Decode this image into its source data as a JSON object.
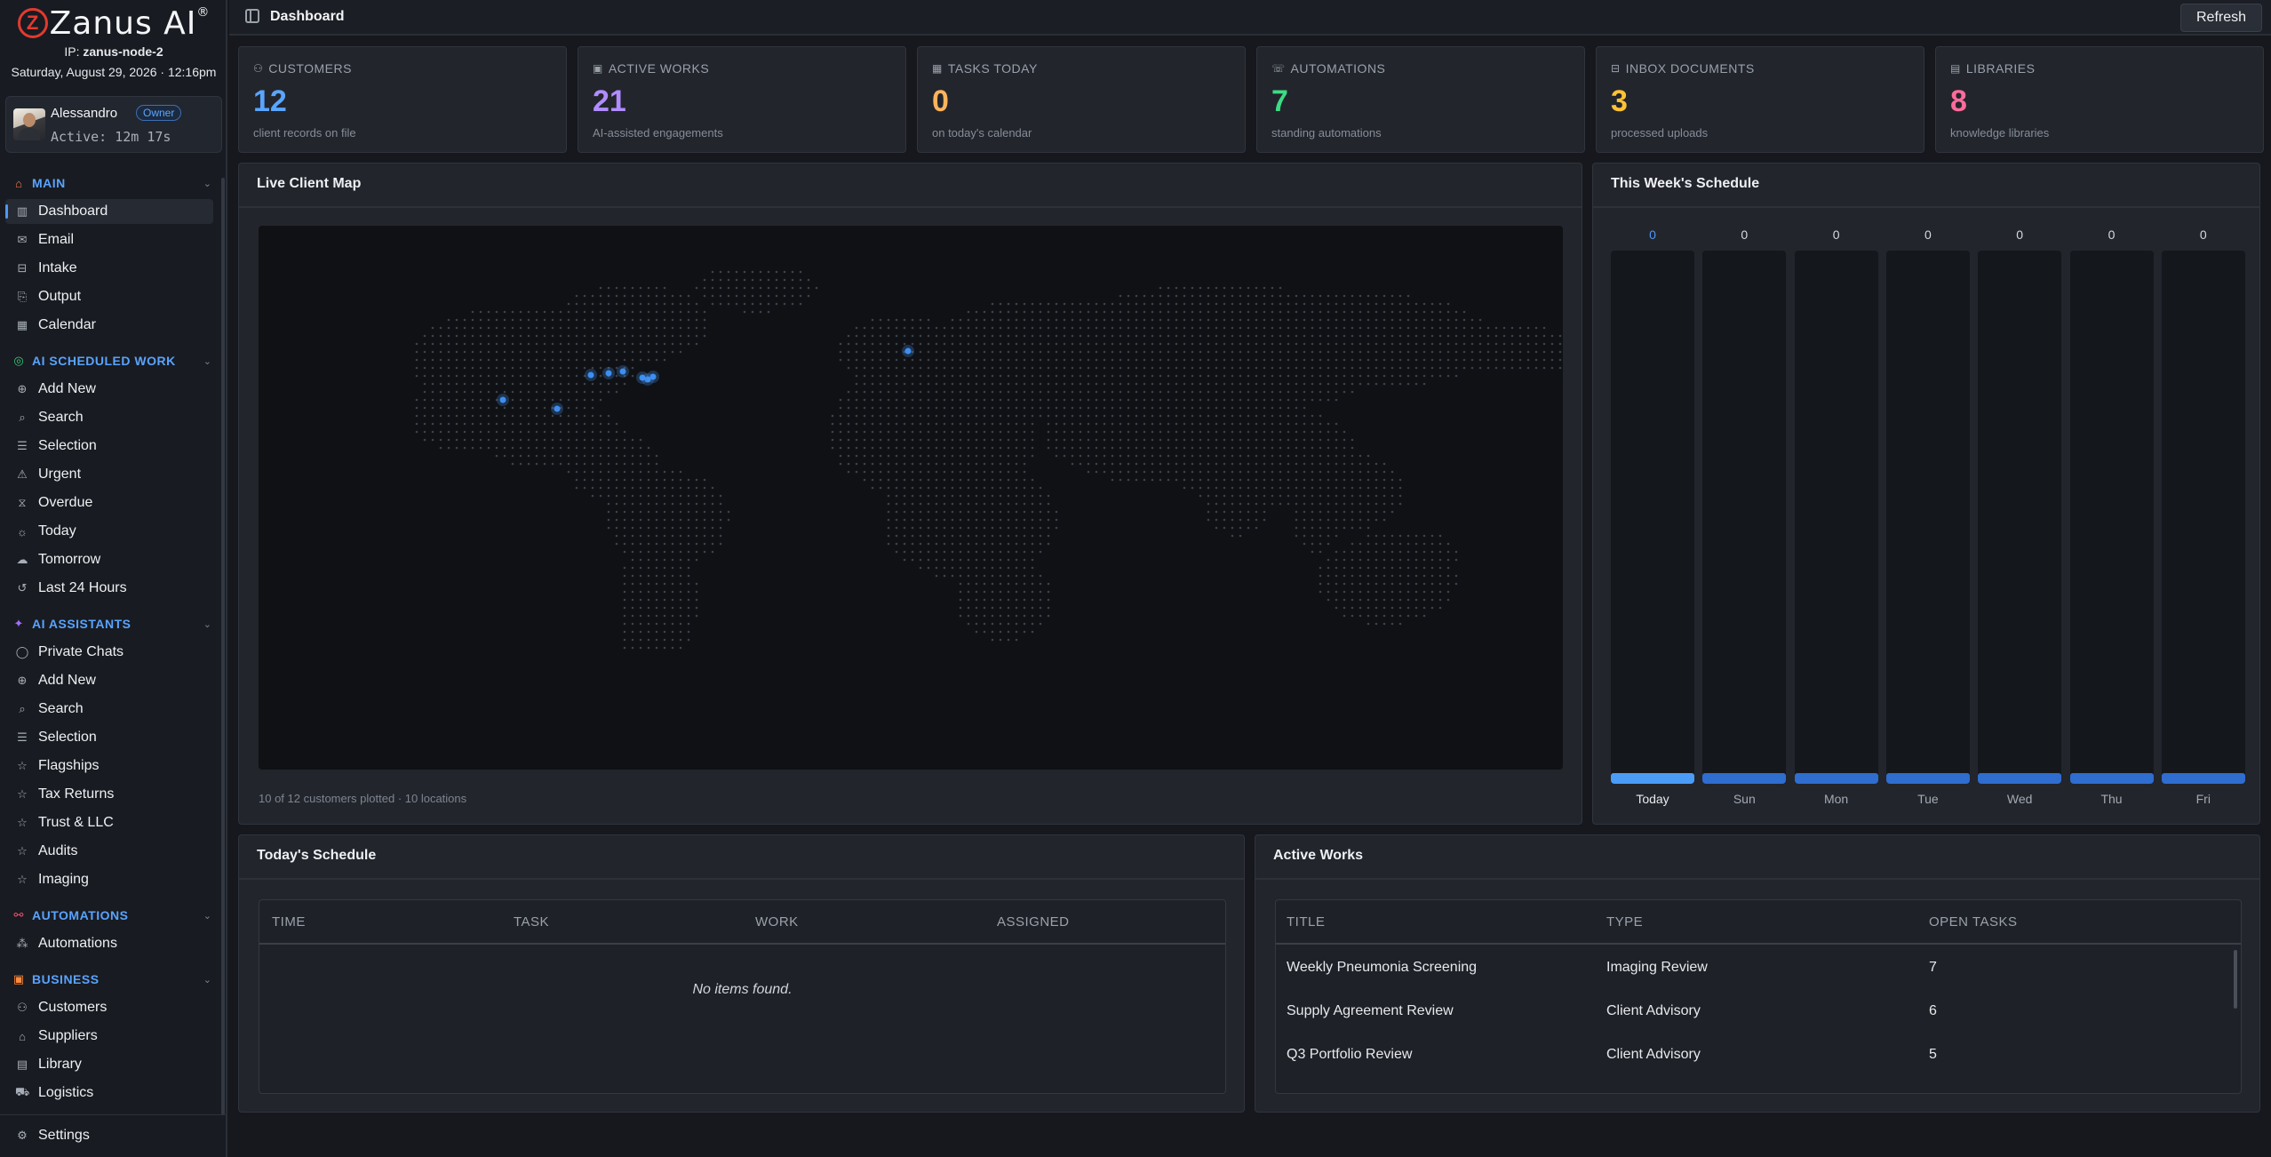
{
  "app": {
    "logo_letter": "Z",
    "logo_text": "Zanus AI",
    "logo_mark": "®",
    "ip_label": "IP: ",
    "ip_value": "zanus-node-2",
    "datetime": "Saturday, August 29, 2026 · 12:16pm"
  },
  "user": {
    "name": "Alessandro",
    "role": "Owner",
    "active": "Active: 12m 17s"
  },
  "sidebar": {
    "sections": [
      {
        "label": "MAIN",
        "icon": "home-icon",
        "color": "#ff7a45"
      },
      {
        "label": "AI SCHEDULED WORK",
        "icon": "scheduled-icon",
        "color": "#37c977"
      },
      {
        "label": "AI ASSISTANTS",
        "icon": "sparkle-icon",
        "color": "#a66bff"
      },
      {
        "label": "AUTOMATIONS",
        "icon": "automation-icon",
        "color": "#ff4d6d"
      },
      {
        "label": "BUSINESS",
        "icon": "briefcase-icon",
        "color": "#ff8a3d"
      }
    ],
    "main": [
      "Dashboard",
      "Email",
      "Intake",
      "Output",
      "Calendar"
    ],
    "scheduled": [
      "Add New",
      "Search",
      "Selection",
      "Urgent",
      "Overdue",
      "Today",
      "Tomorrow",
      "Last 24 Hours"
    ],
    "assistants": [
      "Private Chats",
      "Add New",
      "Search",
      "Selection",
      "Flagships",
      "Tax Returns",
      "Trust & LLC",
      "Audits",
      "Imaging"
    ],
    "automations": [
      "Automations"
    ],
    "business": [
      "Customers",
      "Suppliers",
      "Library",
      "Logistics"
    ],
    "settings": "Settings"
  },
  "header": {
    "title": "Dashboard",
    "refresh": "Refresh"
  },
  "stats": [
    {
      "label": "CUSTOMERS",
      "value": "12",
      "sub": "client records on file",
      "color": "#5aa5ff",
      "icon": "users-icon"
    },
    {
      "label": "ACTIVE WORKS",
      "value": "21",
      "sub": "AI-assisted engagements",
      "color": "#b08cff",
      "icon": "briefcase-icon"
    },
    {
      "label": "TASKS TODAY",
      "value": "0",
      "sub": "on today's calendar",
      "color": "#ffb35c",
      "icon": "calendar-icon"
    },
    {
      "label": "AUTOMATIONS",
      "value": "7",
      "sub": "standing automations",
      "color": "#3ddc84",
      "icon": "phone-icon"
    },
    {
      "label": "INBOX DOCUMENTS",
      "value": "3",
      "sub": "processed uploads",
      "color": "#ffc233",
      "icon": "inbox-icon"
    },
    {
      "label": "LIBRARIES",
      "value": "8",
      "sub": "knowledge libraries",
      "color": "#ff6b9a",
      "icon": "book-icon"
    }
  ],
  "map": {
    "title": "Live Client Map",
    "caption": "10 of 12 customers plotted · 10 locations"
  },
  "week": {
    "title": "This Week's Schedule",
    "days": [
      {
        "label": "Today",
        "count": "0"
      },
      {
        "label": "Sun",
        "count": "0"
      },
      {
        "label": "Mon",
        "count": "0"
      },
      {
        "label": "Tue",
        "count": "0"
      },
      {
        "label": "Wed",
        "count": "0"
      },
      {
        "label": "Thu",
        "count": "0"
      },
      {
        "label": "Fri",
        "count": "0"
      }
    ]
  },
  "today_schedule": {
    "title": "Today's Schedule",
    "columns": [
      "TIME",
      "TASK",
      "WORK",
      "ASSIGNED"
    ],
    "empty": "No items found."
  },
  "active_works": {
    "title": "Active Works",
    "columns": [
      "TITLE",
      "TYPE",
      "OPEN TASKS"
    ],
    "rows": [
      {
        "title": "Weekly Pneumonia Screening",
        "type": "Imaging Review",
        "open": "7"
      },
      {
        "title": "Supply Agreement Review",
        "type": "Client Advisory",
        "open": "6"
      },
      {
        "title": "Q3 Portfolio Review",
        "type": "Client Advisory",
        "open": "5"
      }
    ]
  }
}
